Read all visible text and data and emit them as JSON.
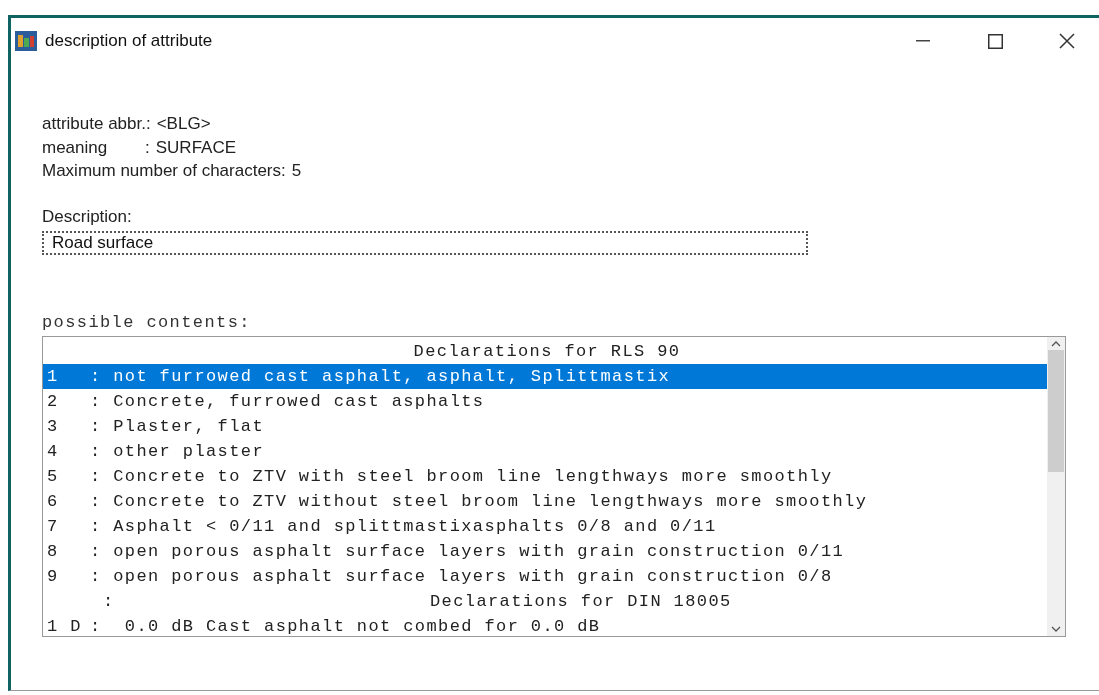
{
  "window": {
    "title": "description of attribute"
  },
  "info": [
    {
      "label": "attribute abbr.:",
      "value": "<BLG>"
    },
    {
      "label": "meaning        :",
      "value": "SURFACE"
    },
    {
      "label": "Maximum number of characters:",
      "value": "5"
    }
  ],
  "description": {
    "label": "Description:",
    "value": "Road surface"
  },
  "contents": {
    "label": "possible contents:",
    "rows": [
      {
        "kind": "header",
        "text": "Declarations for RLS 90",
        "selected": false
      },
      {
        "kind": "item",
        "number": "1",
        "text": ": not furrowed cast asphalt, asphalt, Splittmastix",
        "selected": true
      },
      {
        "kind": "item",
        "number": "2",
        "text": ": Concrete, furrowed cast asphalts",
        "selected": false
      },
      {
        "kind": "item",
        "number": "3",
        "text": ": Plaster, flat",
        "selected": false
      },
      {
        "kind": "item",
        "number": "4",
        "text": ": other plaster",
        "selected": false
      },
      {
        "kind": "item",
        "number": "5",
        "text": ": Concrete to ZTV with steel broom line lengthways more smoothly",
        "selected": false
      },
      {
        "kind": "item",
        "number": "6",
        "text": ": Concrete to ZTV without steel broom line lengthways more smoothly",
        "selected": false
      },
      {
        "kind": "item",
        "number": "7",
        "text": ": Asphalt < 0/11 and splittmastixasphalts 0/8 and 0/11",
        "selected": false
      },
      {
        "kind": "item",
        "number": "8",
        "text": ": open porous asphalt surface layers with grain construction 0/11",
        "selected": false
      },
      {
        "kind": "item",
        "number": "9",
        "text": ": open porous asphalt surface layers with grain construction 0/8",
        "selected": false
      },
      {
        "kind": "header",
        "prefix": ":",
        "text": "Declarations for DIN 18005",
        "selected": false
      },
      {
        "kind": "item",
        "number": "1 D",
        "text": ":  0.0 dB Cast asphalt not combed for 0.0 dB",
        "selected": false
      }
    ]
  }
}
